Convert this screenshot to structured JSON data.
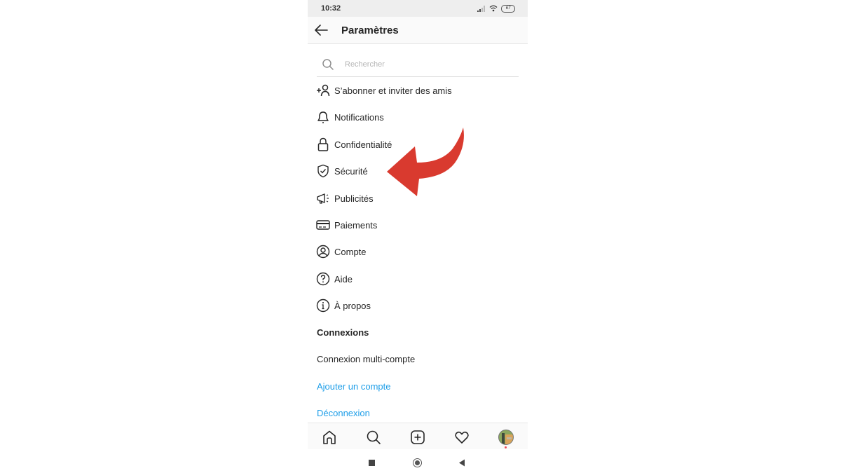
{
  "status_bar": {
    "time": "10:32",
    "battery": "67"
  },
  "header": {
    "title": "Paramètres",
    "back_icon": "arrow-left-icon"
  },
  "search": {
    "placeholder": "Rechercher",
    "value": ""
  },
  "menu": [
    {
      "label": "S’abonner et inviter des amis",
      "icon": "add-person-icon"
    },
    {
      "label": "Notifications",
      "icon": "bell-icon"
    },
    {
      "label": "Confidentialité",
      "icon": "lock-icon"
    },
    {
      "label": "Sécurité",
      "icon": "shield-check-icon"
    },
    {
      "label": "Publicités",
      "icon": "megaphone-icon"
    },
    {
      "label": "Paiements",
      "icon": "credit-card-icon"
    },
    {
      "label": "Compte",
      "icon": "user-circle-icon"
    },
    {
      "label": "Aide",
      "icon": "help-circle-icon"
    },
    {
      "label": "À propos",
      "icon": "info-circle-icon"
    }
  ],
  "connections": {
    "heading": "Connexions",
    "multi_account": "Connexion multi-compte",
    "add_account": "Ajouter un compte",
    "logout": "Déconnexion"
  },
  "tab_bar": [
    "home-icon",
    "search-icon",
    "new-post-icon",
    "heart-icon",
    "profile-avatar"
  ],
  "colors": {
    "link": "#1e9ee8",
    "annotation_arrow": "#d93a2f",
    "notification_dot": "#ed4956"
  },
  "annotation": {
    "type": "curved-arrow",
    "points_to": "Sécurité"
  }
}
